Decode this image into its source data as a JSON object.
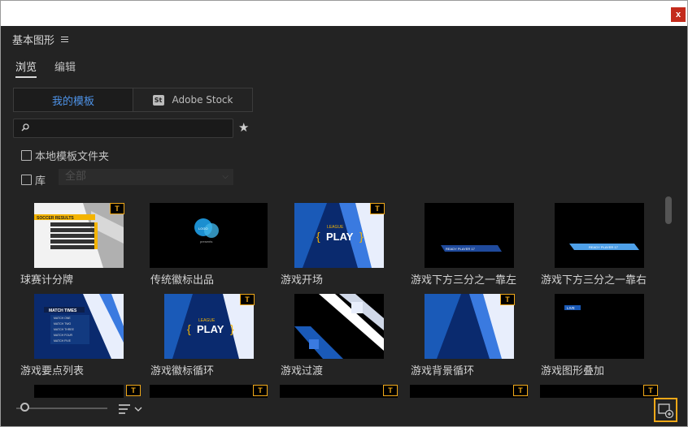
{
  "window": {
    "close_label": "x"
  },
  "panel": {
    "title": "基本图形",
    "tabs": [
      {
        "label": "浏览",
        "active": true
      },
      {
        "label": "编辑",
        "active": false
      }
    ],
    "sources": [
      {
        "label": "我的模板",
        "active": true
      },
      {
        "label": "Adobe Stock",
        "badge": "St",
        "active": false
      }
    ],
    "search": {
      "value": "",
      "placeholder": ""
    },
    "local_templates_folder": {
      "label": "本地模板文件夹",
      "checked": false
    },
    "library": {
      "label": "库",
      "checked": false,
      "selected": "全部"
    },
    "accent_color": "#4e93e8",
    "badge_color": "#f0a818"
  },
  "templates": [
    {
      "label": "球赛计分牌",
      "icon": "text-template-icon",
      "badge": "T"
    },
    {
      "label": "传统徽标出品",
      "icon": "logo-template-icon",
      "badge": ""
    },
    {
      "label": "游戏开场",
      "icon": "text-template-icon",
      "badge": "T"
    },
    {
      "label": "游戏下方三分之一靠左",
      "icon": "",
      "badge": ""
    },
    {
      "label": "游戏下方三分之一靠右",
      "icon": "",
      "badge": ""
    },
    {
      "label": "游戏要点列表",
      "icon": "",
      "badge": ""
    },
    {
      "label": "游戏徽标循环",
      "icon": "text-template-icon",
      "badge": "T"
    },
    {
      "label": "游戏过渡",
      "icon": "",
      "badge": ""
    },
    {
      "label": "游戏背景循环",
      "icon": "text-template-icon",
      "badge": "T"
    },
    {
      "label": "游戏图形叠加",
      "icon": "",
      "badge": ""
    }
  ],
  "thumb_texts": {
    "scoreboard_title": "SOCCER RESULTS",
    "logo_text": "LOGO",
    "logo_sub": "presents",
    "play_small": "LEAGUE",
    "play_big": "PLAY",
    "player_text": "READY PLAYER 17",
    "match_title": "MATCH TIMES",
    "match_items": [
      "MATCH ONE",
      "MATCH TWO",
      "MATCH THREE",
      "MATCH FOUR",
      "MATCH FIVE"
    ],
    "overlay_text": "LIVE"
  },
  "footer": {
    "zoom_level": 0.1
  }
}
